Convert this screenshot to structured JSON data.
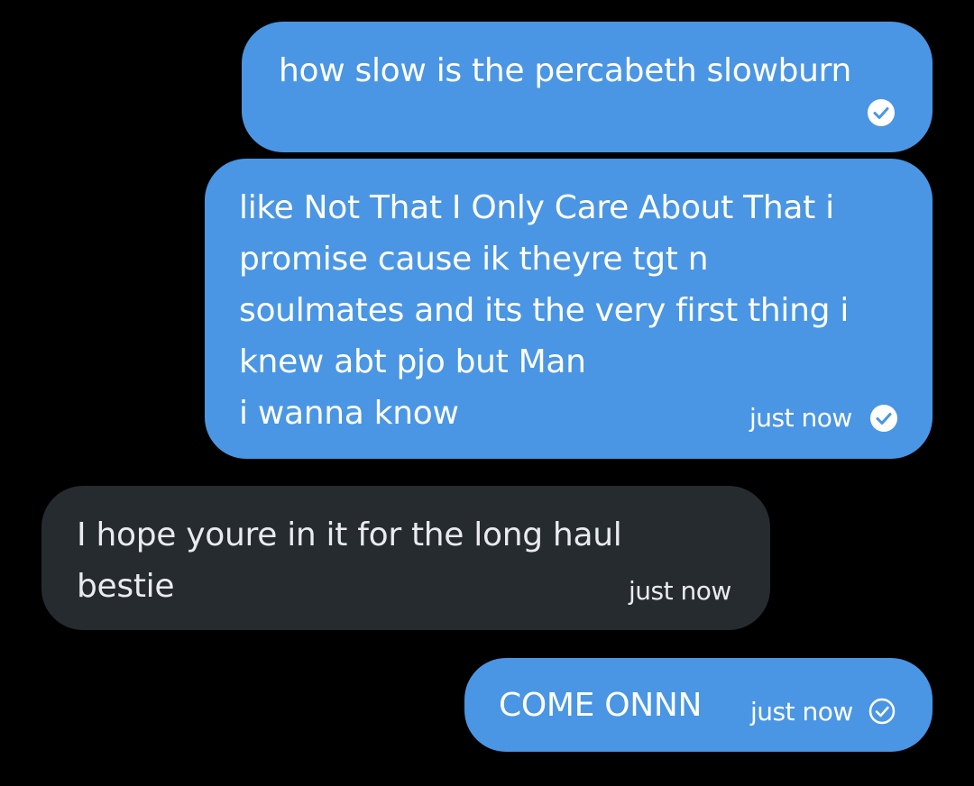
{
  "colors": {
    "background": "#000000",
    "sent_bubble": "#4a96e4",
    "received_bubble": "#262b30",
    "text": "#ffffff"
  },
  "messages": [
    {
      "direction": "sent",
      "text": "how slow is the percabeth slowburn",
      "time": "",
      "status_icon": "read-check-icon"
    },
    {
      "direction": "sent",
      "text": "like Not That I Only Care About That i\npromise cause ik theyre tgt n\nsoulmates and its the very first thing i\nknew abt pjo but Man\ni wanna know",
      "time": "just now",
      "status_icon": "read-check-icon"
    },
    {
      "direction": "received",
      "text": "I hope youre in it for the long haul\nbestie",
      "time": "just now"
    },
    {
      "direction": "sent",
      "text": "COME ONNN",
      "time": "just now",
      "status_icon": "sent-check-icon"
    }
  ]
}
